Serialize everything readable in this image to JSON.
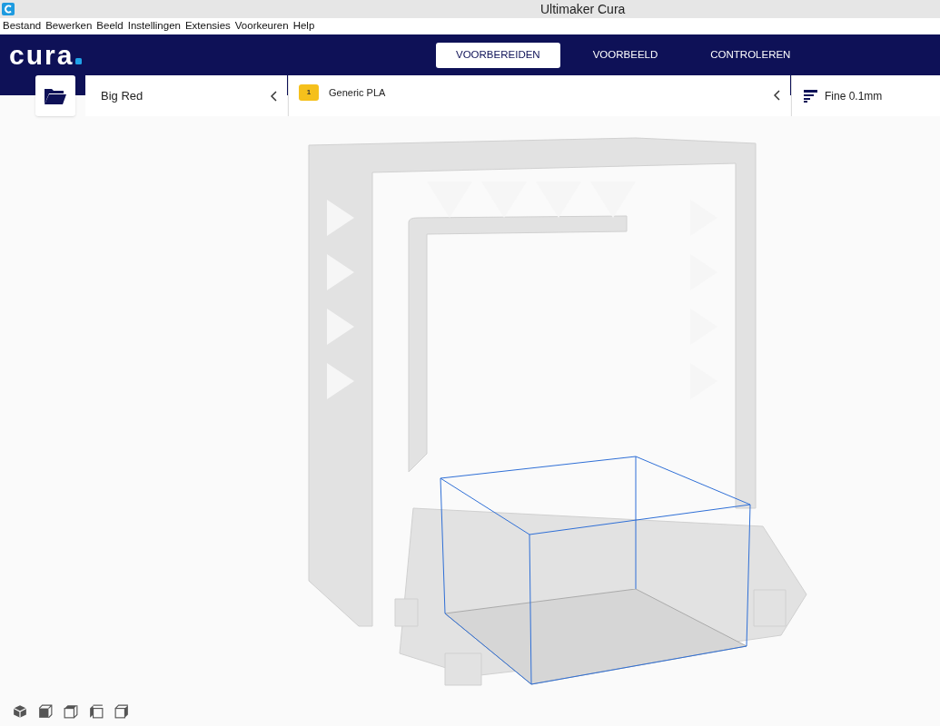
{
  "window": {
    "title": "Ultimaker Cura"
  },
  "menu": [
    "Bestand",
    "Bewerken",
    "Beeld",
    "Instellingen",
    "Extensies",
    "Voorkeuren",
    "Help"
  ],
  "logo": "cura",
  "tabs": [
    {
      "label": "VOORBEREIDEN",
      "selected": true
    },
    {
      "label": "VOORBEELD",
      "selected": false
    },
    {
      "label": "CONTROLEREN",
      "selected": false
    }
  ],
  "printer": {
    "name": "Big Red"
  },
  "material": {
    "extruder": "1",
    "name": "Generic PLA"
  },
  "profile": {
    "name": "Fine 0.1mm"
  },
  "view_buttons": [
    {
      "kind": "perspective"
    },
    {
      "kind": "front"
    },
    {
      "kind": "top"
    },
    {
      "kind": "left"
    },
    {
      "kind": "right"
    }
  ]
}
